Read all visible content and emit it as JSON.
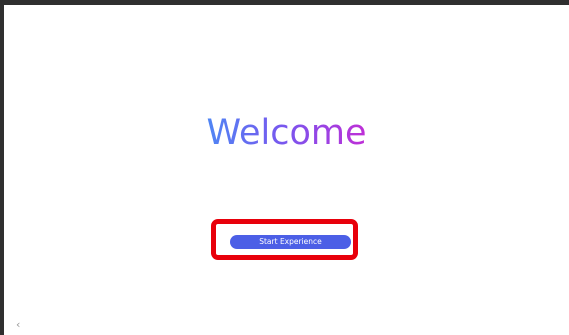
{
  "welcome": {
    "title": "Welcome",
    "gradient_colors": [
      "#4e86f4",
      "#7a55ee",
      "#c02ed6"
    ]
  },
  "start_button": {
    "label": "Start Experience",
    "color": "#4c5fe6",
    "highlight_color": "#e8000b"
  },
  "nav": {
    "back_glyph": "‹",
    "back_icon": "chevron-left-icon"
  }
}
